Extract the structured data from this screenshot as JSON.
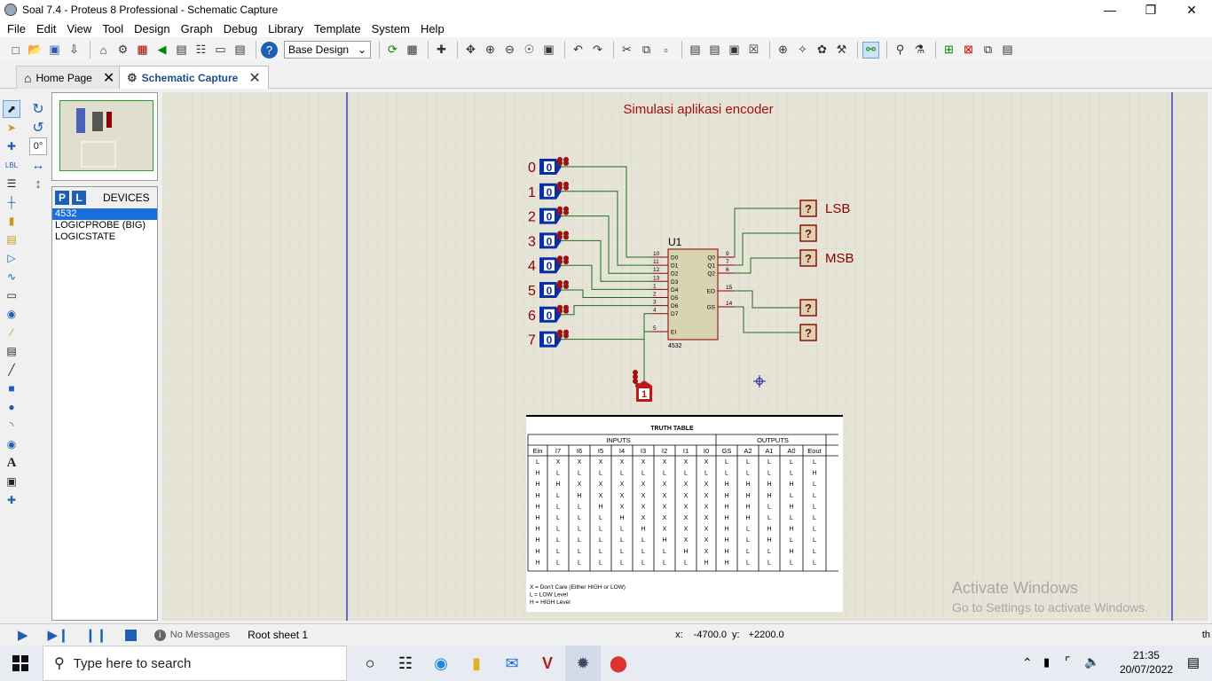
{
  "window": {
    "title": "Soal 7.4 - Proteus 8 Professional - Schematic Capture"
  },
  "menu": [
    "File",
    "Edit",
    "View",
    "Tool",
    "Design",
    "Graph",
    "Debug",
    "Library",
    "Template",
    "System",
    "Help"
  ],
  "toolbar": {
    "design_select": "Base Design"
  },
  "tabs": [
    {
      "label": "Home Page"
    },
    {
      "label": "Schematic Capture"
    }
  ],
  "left": {
    "rotation": "0°"
  },
  "devices": {
    "header": "DEVICES",
    "items": [
      "4532",
      "LOGICPROBE (BIG)",
      "LOGICSTATE"
    ],
    "selected": "4532"
  },
  "schematic": {
    "title": "Simulasi aplikasi encoder",
    "inputs": [
      "0",
      "1",
      "2",
      "3",
      "4",
      "5",
      "6",
      "7"
    ],
    "input_state": "0",
    "enable_state": "1",
    "ic": {
      "ref": "U1",
      "part": "4532",
      "left_pins": [
        [
          "10",
          "D0"
        ],
        [
          "11",
          "D1"
        ],
        [
          "12",
          "D2"
        ],
        [
          "13",
          "D3"
        ],
        [
          "1",
          "D4"
        ],
        [
          "2",
          "D5"
        ],
        [
          "3",
          "D6"
        ],
        [
          "4",
          "D7"
        ],
        [
          "5",
          "EI"
        ]
      ],
      "right_pins": [
        [
          "9",
          "Q0"
        ],
        [
          "7",
          "Q1"
        ],
        [
          "6",
          "Q2"
        ],
        [
          "15",
          "EO"
        ],
        [
          "14",
          "GS"
        ]
      ]
    },
    "probe": "?",
    "probe_labels": {
      "lsb": "LSB",
      "msb": "MSB"
    }
  },
  "truth_table": {
    "title": "TRUTH TABLE",
    "group_inputs": "INPUTS",
    "group_outputs": "OUTPUTS",
    "headers": [
      "Ein",
      "I7",
      "I6",
      "I5",
      "I4",
      "I3",
      "I2",
      "I1",
      "I0",
      "GS",
      "A2",
      "A1",
      "A0",
      "Eout"
    ],
    "rows": [
      [
        "L",
        "X",
        "X",
        "X",
        "X",
        "X",
        "X",
        "X",
        "X",
        "L",
        "L",
        "L",
        "L",
        "L"
      ],
      [
        "H",
        "L",
        "L",
        "L",
        "L",
        "L",
        "L",
        "L",
        "L",
        "L",
        "L",
        "L",
        "L",
        "H"
      ],
      [
        "H",
        "H",
        "X",
        "X",
        "X",
        "X",
        "X",
        "X",
        "X",
        "H",
        "H",
        "H",
        "H",
        "L"
      ],
      [
        "H",
        "L",
        "H",
        "X",
        "X",
        "X",
        "X",
        "X",
        "X",
        "H",
        "H",
        "H",
        "L",
        "L"
      ],
      [
        "H",
        "L",
        "L",
        "H",
        "X",
        "X",
        "X",
        "X",
        "X",
        "H",
        "H",
        "L",
        "H",
        "L"
      ],
      [
        "H",
        "L",
        "L",
        "L",
        "H",
        "X",
        "X",
        "X",
        "X",
        "H",
        "H",
        "L",
        "L",
        "L"
      ],
      [
        "H",
        "L",
        "L",
        "L",
        "L",
        "H",
        "X",
        "X",
        "X",
        "H",
        "L",
        "H",
        "H",
        "L"
      ],
      [
        "H",
        "L",
        "L",
        "L",
        "L",
        "L",
        "H",
        "X",
        "X",
        "H",
        "L",
        "H",
        "L",
        "L"
      ],
      [
        "H",
        "L",
        "L",
        "L",
        "L",
        "L",
        "L",
        "H",
        "X",
        "H",
        "L",
        "L",
        "H",
        "L"
      ],
      [
        "H",
        "L",
        "L",
        "L",
        "L",
        "L",
        "L",
        "L",
        "H",
        "H",
        "L",
        "L",
        "L",
        "L"
      ]
    ],
    "notes": [
      "X = Don't Care (Either HIGH or LOW)",
      "L = LOW Level",
      "H = HIGH Level"
    ]
  },
  "status": {
    "messages": "No Messages",
    "sheet": "Root sheet 1",
    "x_label": "x:",
    "x": "-4700.0",
    "y_label": "y:",
    "y": "+2200.0",
    "tail": "th"
  },
  "watermark": {
    "line1": "Activate Windows",
    "line2": "Go to Settings to activate Windows."
  },
  "taskbar": {
    "search_placeholder": "Type here to search",
    "time": "21:35",
    "date": "20/07/2022"
  },
  "colors": {
    "wire": "#1f6b1f",
    "pin": "#8b0000",
    "state_blue": "#0a2ea8",
    "probe_red": "#c01818",
    "ic_fill": "#d8d3b0"
  }
}
